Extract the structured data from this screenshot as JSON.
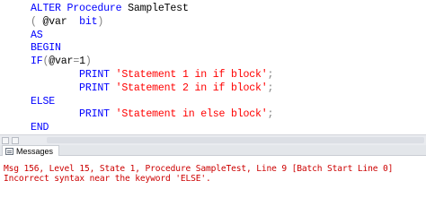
{
  "editor": {
    "lines": [
      {
        "tokens": [
          {
            "t": "ALTER ",
            "c": "kw"
          },
          {
            "t": "Procedure ",
            "c": "kw"
          },
          {
            "t": "SampleTest",
            "c": "pl"
          }
        ]
      },
      {
        "tokens": [
          {
            "t": "( ",
            "c": "gr"
          },
          {
            "t": "@var  ",
            "c": "pl"
          },
          {
            "t": "bit",
            "c": "kw"
          },
          {
            "t": ")",
            "c": "gr"
          }
        ]
      },
      {
        "tokens": [
          {
            "t": "AS",
            "c": "kw"
          }
        ]
      },
      {
        "tokens": [
          {
            "t": "BEGIN",
            "c": "kw"
          }
        ]
      },
      {
        "tokens": [
          {
            "t": "IF",
            "c": "kw"
          },
          {
            "t": "(",
            "c": "gr"
          },
          {
            "t": "@var",
            "c": "pl"
          },
          {
            "t": "=",
            "c": "gr"
          },
          {
            "t": "1",
            "c": "pl"
          },
          {
            "t": ")",
            "c": "gr"
          }
        ]
      },
      {
        "tokens": [
          {
            "t": "        PRINT ",
            "c": "kw"
          },
          {
            "t": "'Statement 1 in if block'",
            "c": "st"
          },
          {
            "t": ";",
            "c": "gr"
          }
        ]
      },
      {
        "tokens": [
          {
            "t": "        PRINT ",
            "c": "kw"
          },
          {
            "t": "'Statement 2 in if block'",
            "c": "st"
          },
          {
            "t": ";",
            "c": "gr"
          }
        ]
      },
      {
        "tokens": [
          {
            "t": "ELSE",
            "c": "kw"
          }
        ]
      },
      {
        "tokens": [
          {
            "t": "        PRINT ",
            "c": "kw"
          },
          {
            "t": "'Statement in else block'",
            "c": "st"
          },
          {
            "t": ";",
            "c": "gr"
          }
        ]
      },
      {
        "tokens": [
          {
            "t": "END",
            "c": "kw"
          }
        ]
      }
    ]
  },
  "results": {
    "tab_label": "Messages",
    "error_line_1": "Msg 156, Level 15, State 1, Procedure SampleTest, Line 9 [Batch Start Line 0]",
    "error_line_2": "Incorrect syntax near the keyword 'ELSE'."
  },
  "colors": {
    "keyword": "#0000ff",
    "string": "#ff0000",
    "operator": "#808080",
    "error": "#cc0000"
  }
}
